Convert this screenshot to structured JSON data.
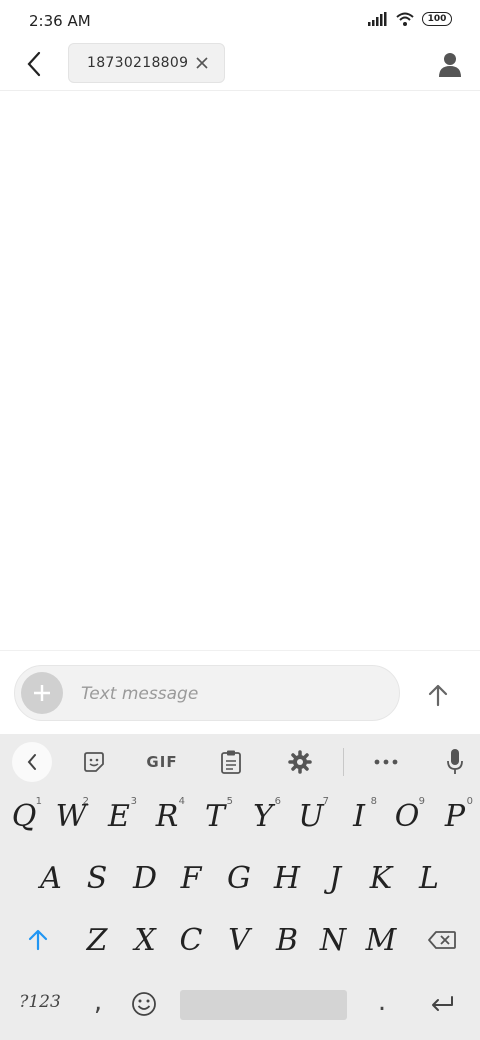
{
  "status_bar": {
    "time": "2:36 AM",
    "battery": "100"
  },
  "header": {
    "recipient": "18730218809"
  },
  "composer": {
    "placeholder": "Text message"
  },
  "keyboard": {
    "toolbar_gif": "GIF",
    "row1": [
      {
        "letter": "Q",
        "num": "1"
      },
      {
        "letter": "W",
        "num": "2"
      },
      {
        "letter": "E",
        "num": "3"
      },
      {
        "letter": "R",
        "num": "4"
      },
      {
        "letter": "T",
        "num": "5"
      },
      {
        "letter": "Y",
        "num": "6"
      },
      {
        "letter": "U",
        "num": "7"
      },
      {
        "letter": "I",
        "num": "8"
      },
      {
        "letter": "O",
        "num": "9"
      },
      {
        "letter": "P",
        "num": "0"
      }
    ],
    "row2": [
      "A",
      "S",
      "D",
      "F",
      "G",
      "H",
      "J",
      "K",
      "L"
    ],
    "row3": [
      "Z",
      "X",
      "C",
      "V",
      "B",
      "N",
      "M"
    ],
    "symbols_label": "?123",
    "comma_label": ",",
    "period_label": "."
  },
  "icons": {
    "back": "chevron-left-icon",
    "clear": "close-icon",
    "contact": "person-icon",
    "attach": "plus-icon",
    "send": "arrow-up-icon",
    "kb_collapse": "chevron-left-icon",
    "sticker": "sticker-icon",
    "clipboard": "clipboard-icon",
    "settings": "gear-icon",
    "more": "more-icon",
    "mic": "mic-icon",
    "shift": "shift-arrow-icon",
    "backspace": "backspace-icon",
    "emoji": "emoji-icon",
    "enter": "enter-icon"
  }
}
